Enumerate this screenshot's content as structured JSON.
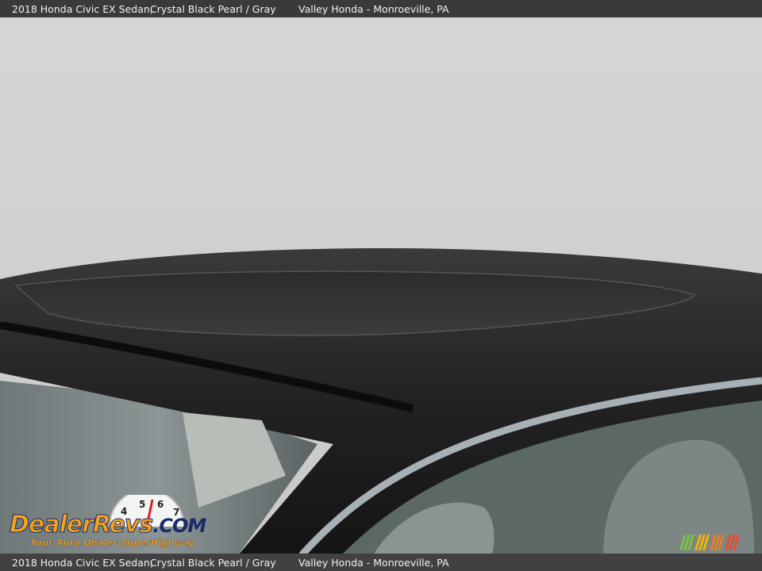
{
  "caption": {
    "vehicle": "2018 Honda Civic EX Sedan,",
    "color": "Crystal Black Pearl / Gray",
    "dealer": "Valley Honda - Monroeville, PA"
  },
  "photo": {
    "subject": "car-roof-sunroof-photo"
  },
  "watermark": {
    "brand_main": "DealerRevs",
    "brand_suffix": ".COM",
    "tagline": "Your Auto Dealer SuperHighway",
    "gauge_digits": [
      "4",
      "5",
      "6",
      "7"
    ],
    "stripe_colors": [
      "#7cc242",
      "#f5b800",
      "#f07c1e",
      "#e84a2b"
    ]
  }
}
